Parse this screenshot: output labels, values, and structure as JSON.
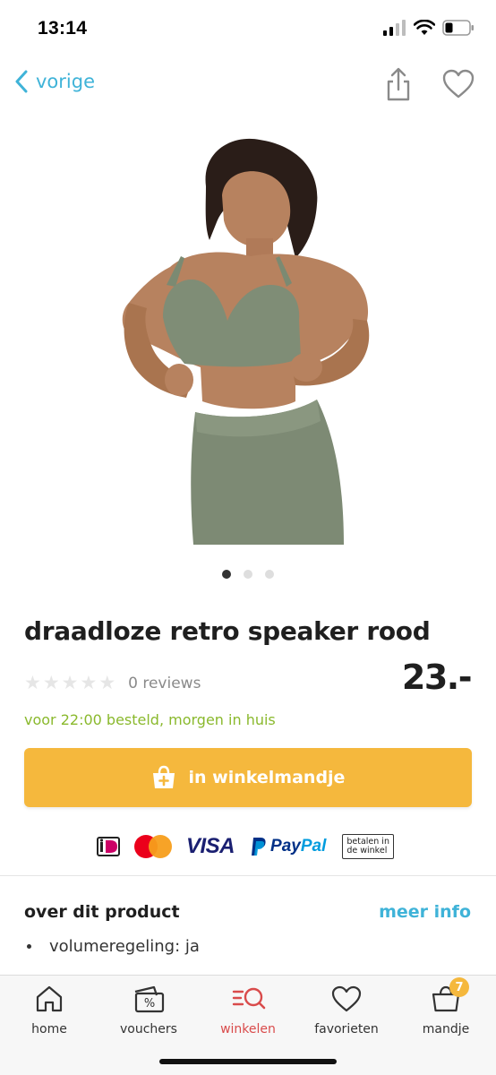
{
  "status_bar": {
    "time": "13:14"
  },
  "nav": {
    "back_label": "vorige",
    "icons": {
      "back": "chevron-left-icon",
      "share": "share-icon",
      "favorite": "heart-icon"
    }
  },
  "product": {
    "image_alt": "model in green wireless bra and leggings",
    "pager": {
      "count": 3,
      "active": 0
    },
    "title": "draadloze retro speaker rood",
    "rating": {
      "stars": 0,
      "max": 5,
      "reviews_label": "0 reviews"
    },
    "price": "23.-",
    "delivery": "voor 22:00 besteld, morgen in huis",
    "cart_button_label": "in winkelmandje"
  },
  "payments": {
    "methods": [
      "iDEAL",
      "Mastercard",
      "VISA",
      "PayPal",
      "betalen in de winkel"
    ],
    "visa_text": "VISA",
    "paypal_pay": "Pay",
    "paypal_pal": "Pal",
    "store_text_line1": "betalen in",
    "store_text_line2": "de winkel"
  },
  "about": {
    "title": "over dit product",
    "more_info": "meer info",
    "features": [
      "volumeregeling: ja"
    ]
  },
  "tab_bar": {
    "tabs": [
      {
        "label": "home",
        "icon": "home-icon"
      },
      {
        "label": "vouchers",
        "icon": "voucher-icon"
      },
      {
        "label": "winkelen",
        "icon": "shop-search-icon",
        "active": true
      },
      {
        "label": "favorieten",
        "icon": "heart-icon"
      },
      {
        "label": "mandje",
        "icon": "basket-icon",
        "badge": "7"
      }
    ]
  },
  "colors": {
    "accent_blue": "#3fb3d8",
    "cart_yellow": "#f5b83d",
    "delivery_green": "#8ab92d",
    "active_tab_red": "#d94b4b"
  }
}
